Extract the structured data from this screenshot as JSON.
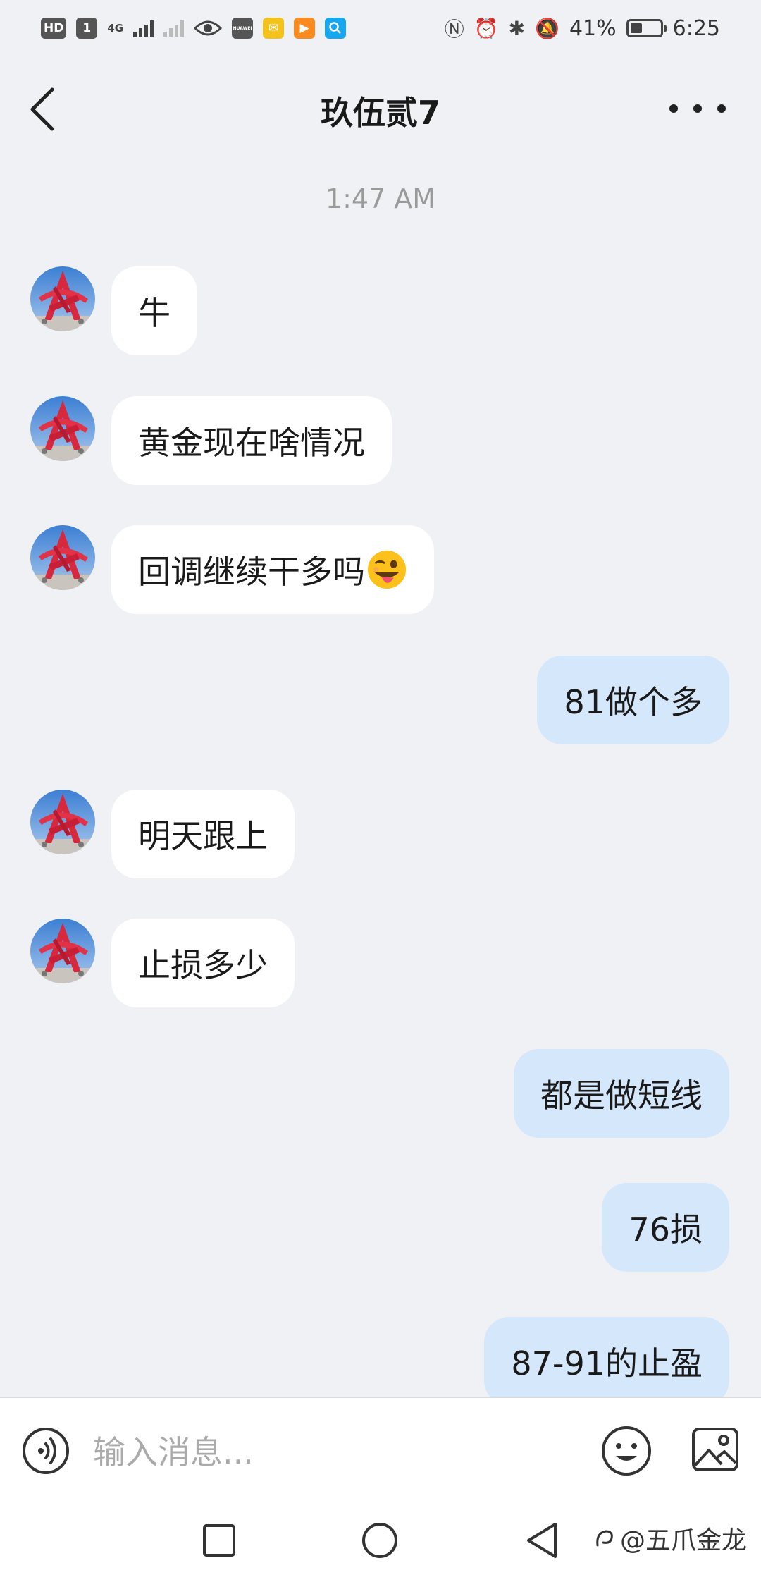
{
  "status_bar": {
    "hd_badge": "HD",
    "sim_badge": "1",
    "network": "4G",
    "brand_badge": "HUAWEI",
    "battery_text": "41%",
    "battery_level": 0.41,
    "time": "6:25"
  },
  "header": {
    "title": "玖伍贰7"
  },
  "timestamp": "1:47 AM",
  "messages": [
    {
      "side": "in",
      "text": "牛"
    },
    {
      "side": "in",
      "text": "黄金现在啥情况"
    },
    {
      "side": "in",
      "text": "回调继续干多吗",
      "emoji": "winking-tongue-face-emoji"
    },
    {
      "side": "out",
      "text": "81做个多"
    },
    {
      "side": "in",
      "text": "明天跟上"
    },
    {
      "side": "in",
      "text": "止损多少"
    },
    {
      "side": "out",
      "text": "都是做短线"
    },
    {
      "side": "out",
      "text": "76损"
    },
    {
      "side": "out",
      "text": "87-91的止盈"
    }
  ],
  "input": {
    "placeholder": "输入消息..."
  },
  "watermark": "@五爪金龙",
  "colors": {
    "background": "#eff1f4",
    "incoming_bubble": "#ffffff",
    "outgoing_bubble": "#d4e7fb",
    "avatar_red": "#d8283d",
    "avatar_sky": "#4f8fd9"
  },
  "icons": [
    "back-arrow-icon",
    "more-dots-icon",
    "voice-icon",
    "emoji-icon",
    "image-icon",
    "nav-recents-icon",
    "nav-home-icon",
    "nav-back-icon"
  ]
}
